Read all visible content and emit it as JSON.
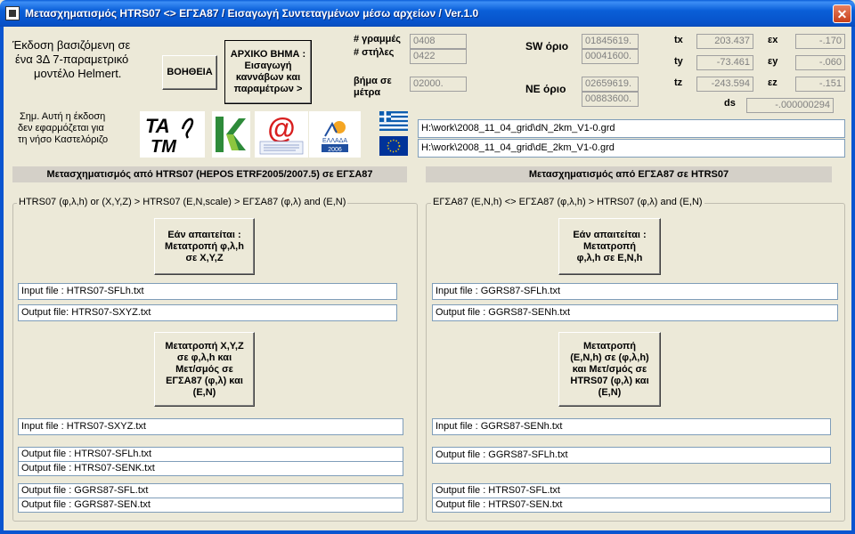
{
  "window": {
    "title": "Μετασχηματισμός HTRS07 <> ΕΓΣΑ87  / Εισαγωγή Συντεταγμένων μέσω αρχείων /  Ver.1.0",
    "close_label": "✕"
  },
  "intro": {
    "line1": "Έκδοση βασιζόμενη σε",
    "line2": "ένα  3Δ 7-παραμετρικό",
    "line3": "μοντέλο Helmert."
  },
  "help_button": "ΒΟΗΘΕΙΑ",
  "first_step_button": {
    "line1": "ΑΡΧΙΚΟ ΒΗΜΑ :",
    "line2": "Εισαγωγή",
    "line3": "καννάβων και",
    "line4": "παραμέτρων >"
  },
  "grid": {
    "rows_label": "# γραμμές",
    "rows_value": "0408",
    "cols_label": "# στήλες",
    "cols_value": "0422",
    "step_label1": "βήμα σε",
    "step_label2": "μέτρα",
    "step_value": "02000."
  },
  "sw": {
    "label": "SW όριο",
    "value1": "01845619.",
    "value2": "00041600."
  },
  "ne": {
    "label": "NE όριο",
    "value1": "02659619.",
    "value2": "00883600."
  },
  "params": {
    "tx_label": "tx",
    "tx": "203.437",
    "ty_label": "ty",
    "ty": "-73.461",
    "tz_label": "tz",
    "tz": "-243.594",
    "ex_label": "εx",
    "ex": "-.170",
    "ey_label": "εy",
    "ey": "-.060",
    "ez_label": "εz",
    "ez": "-.151",
    "ds_label": "ds",
    "ds": "-.000000294"
  },
  "note": {
    "line1": "Σημ. Αυτή η έκδοση",
    "line2": "δεν εφαρμόζεται για",
    "line3": "τη νήσο Καστελόριζο"
  },
  "logos": {
    "tatm_line1": "TA",
    "tatm_line2": "TM",
    "hellas_text": "ΕΛΛΑΔΑ",
    "hellas_year": "2006",
    "at_symbol": "@"
  },
  "grid_files": {
    "dn": "H:\\work\\2008_11_04_grid\\dN_2km_V1-0.grd",
    "de": "H:\\work\\2008_11_04_grid\\dE_2km_V1-0.grd"
  },
  "left": {
    "header": "Μετασχηματισμός από HTRS07 (HEPOS ETRF2005/2007.5)  σε  ΕΓΣΑ87",
    "group_title": "HTRS07 (φ,λ,h) or (X,Y,Z) > HTRS07 (E,N,scale) > ΕΓΣΑ87 (φ,λ) and (E,N)",
    "btn1": {
      "line1": "Εάν απαιτείται :",
      "line2": "Μετατροπή φ,λ,h",
      "line3": "σε  X,Y,Z"
    },
    "input1": "Input file  : HTRS07-SFLh.txt",
    "output1": "Output file: HTRS07-SXYZ.txt",
    "btn2": {
      "line1": "Μετατροπή X,Y,Z",
      "line2": "σε φ,λ,h και",
      "line3": "Μετ/σμός  σε",
      "line4": "ΕΓΣΑ87 (φ,λ) και",
      "line5": "(E,N)"
    },
    "input2": "Input file  : HTRS07-SXYZ.txt",
    "output2a": "Output file : HTRS07-SFLh.txt",
    "output2b": "Output file : HTRS07-SENK.txt",
    "output3a": "Output file : GGRS87-SFL.txt",
    "output3b": "Output file : GGRS87-SEN.txt"
  },
  "right": {
    "header": "Μετασχηματισμός από   ΕΓΣΑ87  σε  HTRS07",
    "group_title": "ΕΓΣΑ87 (E,N,h) <> ΕΓΣΑ87 (φ,λ,h)   > HTRS07 (φ,λ) and (E,N)",
    "btn1": {
      "line1": "Εάν απαιτείται :",
      "line2": "Μετατροπή",
      "line3": "φ,λ,h σε  E,N,h"
    },
    "input1": "Input file  : GGRS87-SFLh.txt",
    "output1": "Output file : GGRS87-SENh.txt",
    "btn2": {
      "line1": "Μετατροπή",
      "line2": "(E,N,h) σε (φ,λ,h)",
      "line3": "και Μετ/σμός σε",
      "line4": "HTRS07 (φ,λ) και",
      "line5": "(E,N)"
    },
    "input2": "Input file  : GGRS87-SENh.txt",
    "output2": "Output file : GGRS87-SFLh.txt",
    "output3a": "Output file : HTRS07-SFL.txt",
    "output3b": "Output file : HTRS07-SEN.txt"
  }
}
